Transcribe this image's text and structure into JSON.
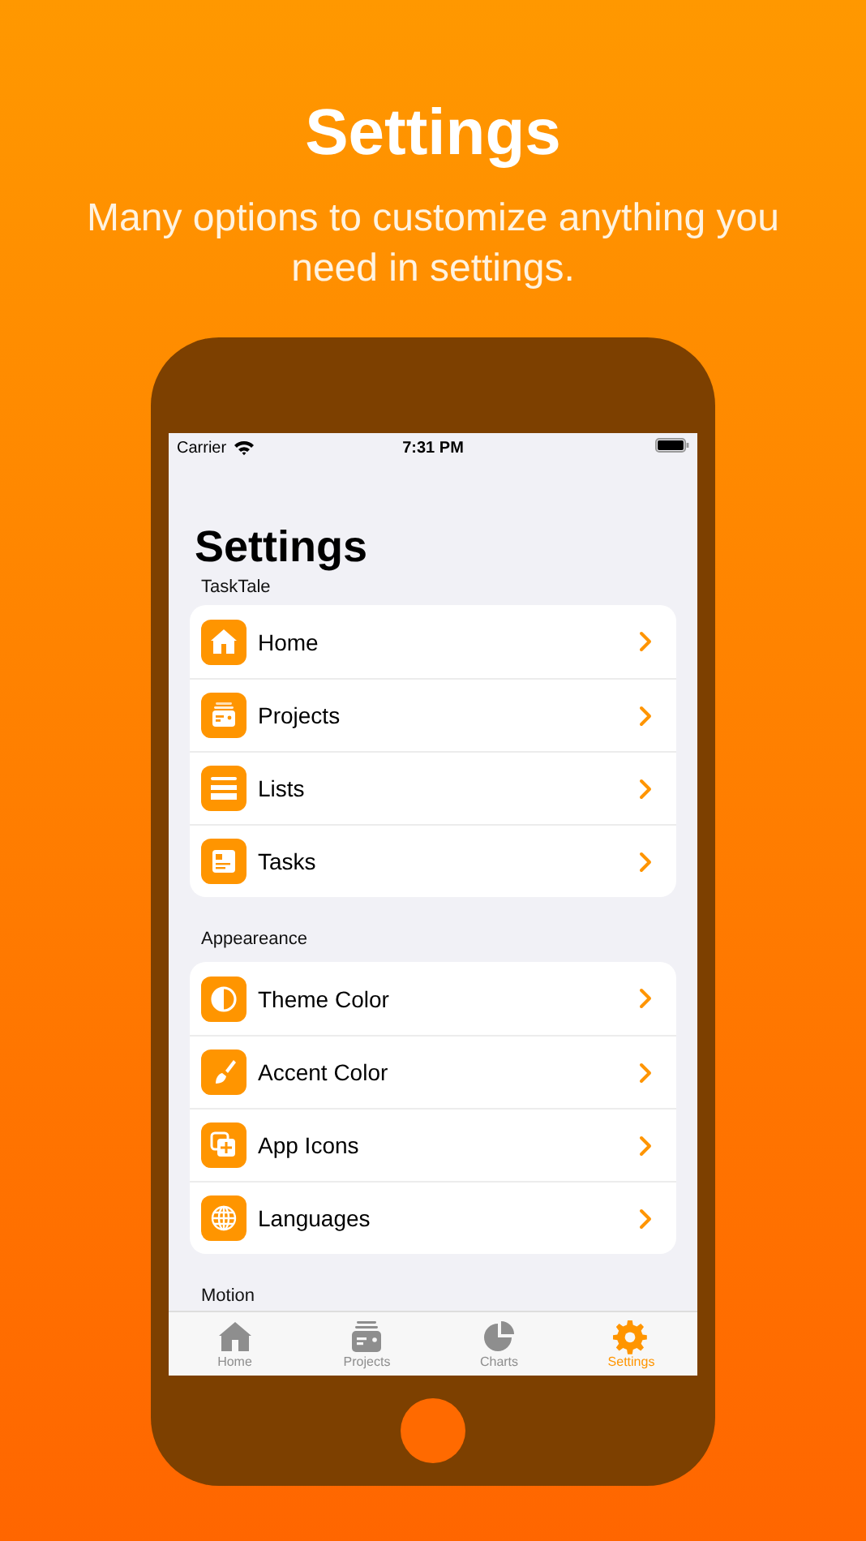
{
  "headline": "Settings",
  "subheadline": "Many options to customize anything you need in settings.",
  "status_bar": {
    "carrier": "Carrier",
    "time": "7:31 PM"
  },
  "screen_title": "Settings",
  "sections": [
    {
      "header": "TaskTale",
      "items": [
        {
          "label": "Home",
          "kind": "home"
        },
        {
          "label": "Projects",
          "kind": "projects"
        },
        {
          "label": "Lists",
          "kind": "lists"
        },
        {
          "label": "Tasks",
          "kind": "tasks"
        }
      ]
    },
    {
      "header": "Appeareance",
      "items": [
        {
          "label": "Theme Color",
          "kind": "theme"
        },
        {
          "label": "Accent Color",
          "kind": "brush"
        },
        {
          "label": "App Icons",
          "kind": "appicons"
        },
        {
          "label": "Languages",
          "kind": "globe"
        }
      ]
    },
    {
      "header": "Motion"
    }
  ],
  "tab_bar": [
    {
      "label": "Home",
      "kind": "home",
      "selected": false
    },
    {
      "label": "Projects",
      "kind": "projects",
      "selected": false
    },
    {
      "label": "Charts",
      "kind": "charts",
      "selected": false
    },
    {
      "label": "Settings",
      "kind": "settings",
      "selected": true
    }
  ]
}
